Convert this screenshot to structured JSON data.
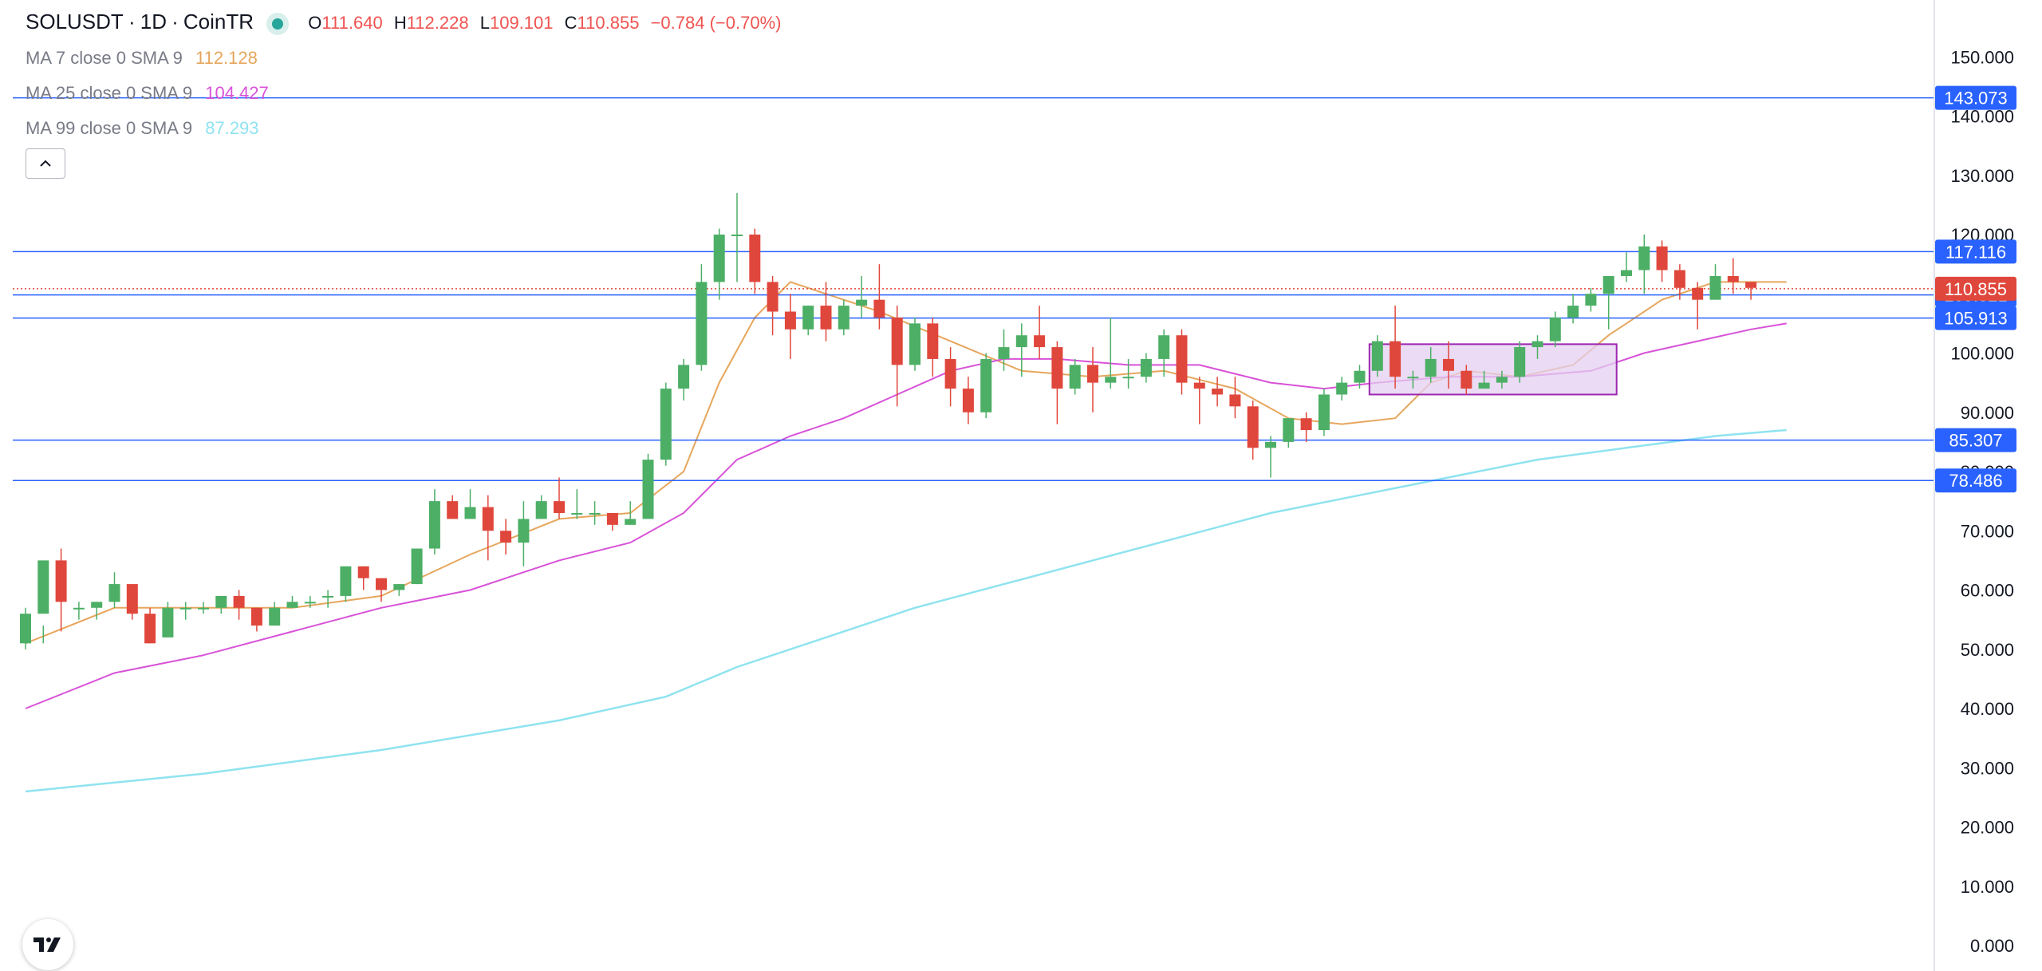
{
  "header": {
    "symbol": "SOLUSDT",
    "sep1": "·",
    "interval": "1D",
    "sep2": "·",
    "exchange": "CoinTR",
    "ohlc": {
      "o_label": "O",
      "o": "111.640",
      "h_label": "H",
      "h": "112.228",
      "l_label": "L",
      "l": "109.101",
      "c_label": "C",
      "c": "110.855",
      "change": "−0.784 (−0.70%)"
    }
  },
  "indicators": [
    {
      "label": "MA 7 close 0 SMA 9",
      "value": "112.128",
      "color": "#e6a65d"
    },
    {
      "label": "MA 25 close 0 SMA 9",
      "value": "104.427",
      "color": "#d852d8"
    },
    {
      "label": "MA 99 close 0 SMA 9",
      "value": "87.293",
      "color": "#8fe3ef"
    }
  ],
  "icons": {
    "collapse": "chevron-up-icon",
    "logo": "tradingview-logo-icon",
    "status": "market-status-dot-icon"
  },
  "colors": {
    "up": "#4caf65",
    "down": "#e0473c",
    "hline": "#2962ff",
    "price_tag": "#e0473c",
    "zone_fill": "#e4cff0",
    "zone_border": "#9c27b0"
  },
  "chart_data": {
    "type": "candlestick",
    "title": "SOLUSDT · 1D · CoinTR",
    "y_axis": {
      "ticks": [
        "150.000",
        "140.000",
        "130.000",
        "120.000",
        "110.000",
        "100.000",
        "90.000",
        "80.000",
        "70.000",
        "60.000",
        "50.000",
        "40.000",
        "30.000",
        "20.000",
        "10.000",
        "0.000"
      ],
      "ylim": [
        0,
        160
      ],
      "position": "right"
    },
    "grid": false,
    "candles": [
      [
        51,
        56,
        50,
        57
      ],
      [
        56,
        65,
        54,
        51
      ],
      [
        65,
        58,
        53,
        67
      ],
      [
        57,
        57,
        55,
        58
      ],
      [
        57,
        58,
        55,
        58
      ],
      [
        58,
        61,
        57,
        63
      ],
      [
        61,
        56,
        55,
        61
      ],
      [
        56,
        51,
        51,
        57
      ],
      [
        52,
        57,
        53,
        58
      ],
      [
        57,
        57,
        55,
        58
      ],
      [
        57,
        57,
        56,
        58
      ],
      [
        57,
        59,
        56,
        59
      ],
      [
        59,
        57,
        55,
        60
      ],
      [
        57,
        54,
        53,
        57
      ],
      [
        54,
        57,
        54,
        58
      ],
      [
        57,
        58,
        57,
        59
      ],
      [
        58,
        58,
        57,
        59
      ],
      [
        59,
        59,
        57,
        60
      ],
      [
        59,
        64,
        58,
        64
      ],
      [
        64,
        62,
        60,
        64
      ],
      [
        62,
        60,
        58,
        62
      ],
      [
        60,
        61,
        59,
        61
      ],
      [
        61,
        67,
        61,
        67
      ],
      [
        67,
        75,
        66,
        77
      ],
      [
        75,
        72,
        72,
        76
      ],
      [
        72,
        74,
        73,
        77
      ],
      [
        74,
        70,
        65,
        76
      ],
      [
        70,
        68,
        66,
        72
      ],
      [
        68,
        72,
        64,
        75
      ],
      [
        72,
        75,
        72,
        76
      ],
      [
        75,
        73,
        72,
        79
      ],
      [
        73,
        73,
        72,
        77
      ],
      [
        73,
        73,
        71,
        75
      ],
      [
        73,
        71,
        70,
        72
      ],
      [
        71,
        72,
        71,
        75
      ],
      [
        72,
        82,
        72,
        83
      ],
      [
        82,
        94,
        81,
        95
      ],
      [
        94,
        98,
        92,
        99
      ],
      [
        98,
        112,
        97,
        115
      ],
      [
        112,
        120,
        109,
        121
      ],
      [
        120,
        120,
        112,
        127
      ],
      [
        120,
        112,
        110,
        121
      ],
      [
        112,
        107,
        103,
        113
      ],
      [
        107,
        104,
        99,
        110
      ],
      [
        104,
        108,
        103,
        108
      ],
      [
        108,
        104,
        102,
        112
      ],
      [
        104,
        108,
        103,
        109
      ],
      [
        108,
        109,
        106,
        113
      ],
      [
        109,
        106,
        104,
        115
      ],
      [
        106,
        98,
        91,
        108
      ],
      [
        98,
        105,
        97,
        106
      ],
      [
        105,
        99,
        96,
        106
      ],
      [
        99,
        94,
        91,
        101
      ],
      [
        94,
        90,
        88,
        96
      ],
      [
        90,
        99,
        89,
        100
      ],
      [
        99,
        101,
        97,
        104
      ],
      [
        101,
        103,
        96,
        105
      ],
      [
        103,
        101,
        99,
        108
      ],
      [
        101,
        94,
        88,
        102
      ],
      [
        94,
        98,
        93,
        99
      ],
      [
        98,
        95,
        90,
        101
      ],
      [
        95,
        96,
        94,
        106
      ],
      [
        96,
        96,
        94,
        99
      ],
      [
        96,
        99,
        95,
        100
      ],
      [
        99,
        103,
        96,
        104
      ],
      [
        103,
        95,
        93,
        104
      ],
      [
        95,
        94,
        88,
        96
      ],
      [
        94,
        93,
        91,
        96
      ],
      [
        93,
        91,
        89,
        96
      ],
      [
        91,
        84,
        82,
        92
      ],
      [
        84,
        85,
        79,
        86
      ],
      [
        85,
        89,
        84,
        89
      ],
      [
        89,
        87,
        85,
        90
      ],
      [
        87,
        93,
        86,
        94
      ],
      [
        93,
        95,
        92,
        96
      ],
      [
        95,
        97,
        94,
        98
      ],
      [
        97,
        102,
        96,
        103
      ],
      [
        102,
        96,
        94,
        108
      ],
      [
        96,
        96,
        94,
        97
      ],
      [
        96,
        99,
        95,
        101
      ],
      [
        99,
        97,
        94,
        102
      ],
      [
        97,
        94,
        93,
        98
      ],
      [
        94,
        95,
        94,
        97
      ],
      [
        95,
        96,
        94,
        97
      ],
      [
        96,
        101,
        95,
        102
      ],
      [
        101,
        102,
        99,
        103
      ],
      [
        102,
        106,
        101,
        107
      ],
      [
        106,
        108,
        105,
        110
      ],
      [
        108,
        110,
        107,
        111
      ],
      [
        110,
        113,
        104,
        113
      ],
      [
        113,
        114,
        112,
        117
      ],
      [
        114,
        118,
        110,
        120
      ],
      [
        118,
        114,
        112,
        119
      ],
      [
        114,
        111,
        109,
        115
      ],
      [
        111,
        109,
        104,
        112
      ],
      [
        109,
        113,
        110,
        115
      ],
      [
        113,
        112,
        110,
        116
      ],
      [
        112,
        111,
        109,
        112
      ]
    ],
    "moving_averages": [
      {
        "name": "MA 7",
        "color": "#e6a65d",
        "points": [
          [
            0,
            51
          ],
          [
            5,
            57
          ],
          [
            10,
            57
          ],
          [
            15,
            57
          ],
          [
            20,
            59
          ],
          [
            25,
            66
          ],
          [
            30,
            72
          ],
          [
            34,
            73
          ],
          [
            37,
            80
          ],
          [
            39,
            95
          ],
          [
            41,
            106
          ],
          [
            43,
            112
          ],
          [
            45,
            110
          ],
          [
            48,
            107
          ],
          [
            52,
            102
          ],
          [
            56,
            97
          ],
          [
            60,
            96
          ],
          [
            64,
            97
          ],
          [
            68,
            94
          ],
          [
            71,
            89
          ],
          [
            74,
            88
          ],
          [
            77,
            89
          ],
          [
            79,
            95
          ],
          [
            81,
            97
          ],
          [
            84,
            96
          ],
          [
            87,
            98
          ],
          [
            89,
            103
          ],
          [
            92,
            109
          ],
          [
            95,
            112
          ],
          [
            97,
            112
          ],
          [
            99,
            112
          ]
        ]
      },
      {
        "name": "MA 25",
        "color": "#d852d8",
        "points": [
          [
            0,
            40
          ],
          [
            5,
            46
          ],
          [
            10,
            49
          ],
          [
            15,
            53
          ],
          [
            20,
            57
          ],
          [
            25,
            60
          ],
          [
            30,
            65
          ],
          [
            34,
            68
          ],
          [
            37,
            73
          ],
          [
            40,
            82
          ],
          [
            43,
            86
          ],
          [
            46,
            89
          ],
          [
            49,
            93
          ],
          [
            52,
            97
          ],
          [
            55,
            99
          ],
          [
            58,
            99
          ],
          [
            62,
            98
          ],
          [
            66,
            98
          ],
          [
            70,
            95
          ],
          [
            73,
            94
          ],
          [
            76,
            95
          ],
          [
            80,
            96
          ],
          [
            84,
            96
          ],
          [
            88,
            97
          ],
          [
            91,
            100
          ],
          [
            94,
            102
          ],
          [
            97,
            104
          ],
          [
            99,
            105
          ]
        ]
      },
      {
        "name": "MA 99",
        "color": "#8fe3ef",
        "points": [
          [
            0,
            26
          ],
          [
            10,
            29
          ],
          [
            20,
            33
          ],
          [
            30,
            38
          ],
          [
            36,
            42
          ],
          [
            40,
            47
          ],
          [
            45,
            52
          ],
          [
            50,
            57
          ],
          [
            55,
            61
          ],
          [
            60,
            65
          ],
          [
            65,
            69
          ],
          [
            70,
            73
          ],
          [
            75,
            76
          ],
          [
            80,
            79
          ],
          [
            85,
            82
          ],
          [
            90,
            84
          ],
          [
            95,
            86
          ],
          [
            99,
            87
          ]
        ]
      }
    ],
    "horizontal_levels": [
      {
        "value": "143.073",
        "color": "#2962ff"
      },
      {
        "value": "117.116",
        "color": "#2962ff"
      },
      {
        "value": "109.821",
        "color": "#2962ff"
      },
      {
        "value": "105.913",
        "color": "#2962ff"
      },
      {
        "value": "85.307",
        "color": "#2962ff"
      },
      {
        "value": "78.486",
        "color": "#2962ff"
      }
    ],
    "last_price": {
      "value": "110.855",
      "color": "#e0473c"
    },
    "zone": {
      "from_index": 76,
      "to_index": 89,
      "y_low": 93,
      "y_high": 101.5,
      "fill": "#e4cff0",
      "border": "#9c27b0"
    }
  }
}
